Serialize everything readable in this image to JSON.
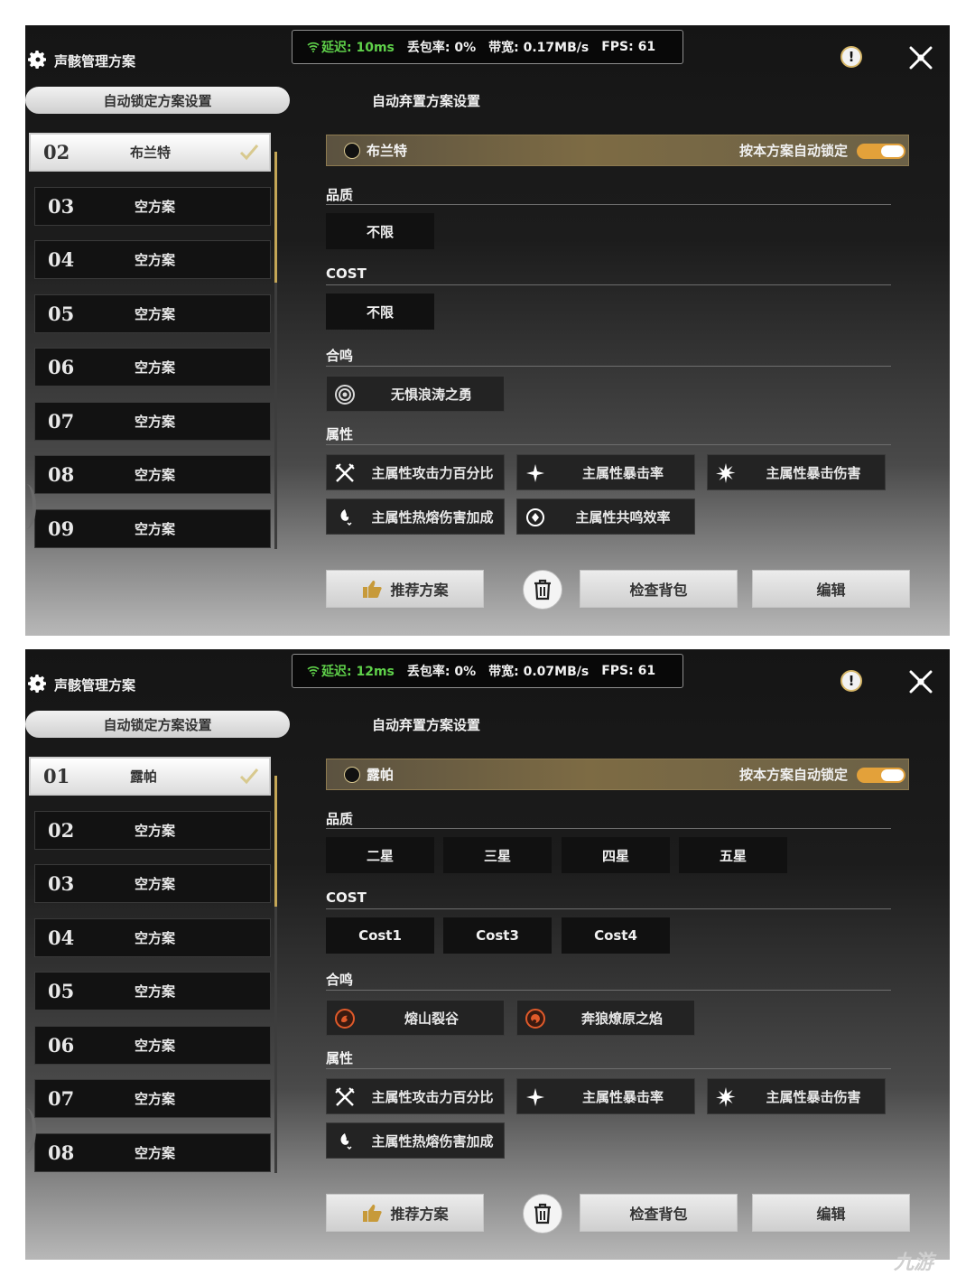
{
  "panels": [
    {
      "title": "声骸管理方案",
      "net": {
        "latency": "延迟: 10ms",
        "loss": "丢包率: 0%",
        "bandwidth": "带宽: 0.17MB/s",
        "fps": "FPS: 61"
      },
      "tab_lock": "自动锁定方案设置",
      "tab_discard": "自动弃置方案设置",
      "plans": [
        {
          "num": "02",
          "name": "布兰特",
          "active": true
        },
        {
          "num": "03",
          "name": "空方案"
        },
        {
          "num": "04",
          "name": "空方案"
        },
        {
          "num": "05",
          "name": "空方案"
        },
        {
          "num": "06",
          "name": "空方案"
        },
        {
          "num": "07",
          "name": "空方案"
        },
        {
          "num": "08",
          "name": "空方案"
        },
        {
          "num": "09",
          "name": "空方案"
        }
      ],
      "hero_name": "布兰特",
      "auto_lock_label": "按本方案自动锁定",
      "auto_lock_on": true,
      "quality_label": "品质",
      "quality": [
        "不限"
      ],
      "cost_label": "COST",
      "cost": [
        "不限"
      ],
      "echo_label": "合鸣",
      "echo": [
        {
          "name": "无惧浪涛之勇",
          "icon": "wave-icon",
          "color": "#d8d8d8"
        }
      ],
      "attr_label": "属性",
      "attrs": [
        {
          "name": "主属性攻击力百分比",
          "icon": "crossed-swords-icon"
        },
        {
          "name": "主属性暴击率",
          "icon": "crit-star-icon"
        },
        {
          "name": "主属性暴击伤害",
          "icon": "burst-icon"
        },
        {
          "name": "主属性热熔伤害加成",
          "icon": "fusion-icon"
        },
        {
          "name": "主属性共鸣效率",
          "icon": "resonance-icon"
        }
      ],
      "buttons": {
        "recommend": "推荐方案",
        "check_bag": "检查背包",
        "edit": "编辑"
      }
    },
    {
      "title": "声骸管理方案",
      "net": {
        "latency": "延迟: 12ms",
        "loss": "丢包率: 0%",
        "bandwidth": "带宽: 0.07MB/s",
        "fps": "FPS: 61"
      },
      "tab_lock": "自动锁定方案设置",
      "tab_discard": "自动弃置方案设置",
      "plans": [
        {
          "num": "01",
          "name": "露帕",
          "active": true
        },
        {
          "num": "02",
          "name": "空方案"
        },
        {
          "num": "03",
          "name": "空方案"
        },
        {
          "num": "04",
          "name": "空方案"
        },
        {
          "num": "05",
          "name": "空方案"
        },
        {
          "num": "06",
          "name": "空方案"
        },
        {
          "num": "07",
          "name": "空方案"
        },
        {
          "num": "08",
          "name": "空方案"
        }
      ],
      "hero_name": "露帕",
      "auto_lock_label": "按本方案自动锁定",
      "auto_lock_on": true,
      "quality_label": "品质",
      "quality": [
        "二星",
        "三星",
        "四星",
        "五星"
      ],
      "cost_label": "COST",
      "cost": [
        "Cost1",
        "Cost3",
        "Cost4"
      ],
      "echo_label": "合鸣",
      "echo": [
        {
          "name": "熔山裂谷",
          "icon": "molten-rift-icon",
          "color": "#e05a2a"
        },
        {
          "name": "奔狼燎原之焰",
          "icon": "wolf-flame-icon",
          "color": "#e05a2a"
        }
      ],
      "attr_label": "属性",
      "attrs": [
        {
          "name": "主属性攻击力百分比",
          "icon": "crossed-swords-icon"
        },
        {
          "name": "主属性暴击率",
          "icon": "crit-star-icon"
        },
        {
          "name": "主属性暴击伤害",
          "icon": "burst-icon"
        },
        {
          "name": "主属性热熔伤害加成",
          "icon": "fusion-icon"
        }
      ],
      "buttons": {
        "recommend": "推荐方案",
        "check_bag": "检查背包",
        "edit": "编辑"
      }
    }
  ],
  "watermark": "九游"
}
